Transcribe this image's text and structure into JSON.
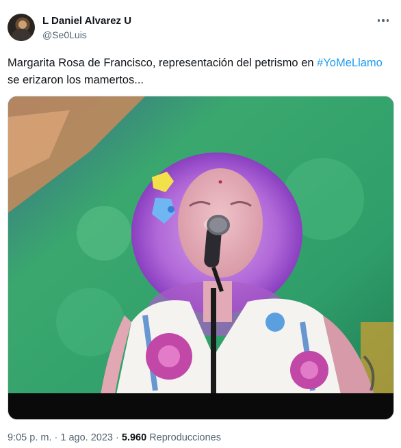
{
  "author": {
    "name": "L Daniel Alvarez U",
    "handle": "@Se0Luis"
  },
  "tweet": {
    "text_before": "Margarita Rosa de Francisco, representación del petrismo en ",
    "hashtag": "#YoMeLlamo",
    "text_after": " se erizaron los mamertos..."
  },
  "meta": {
    "time": "9:05 p. m.",
    "separator": " · ",
    "date": "1 ago. 2023",
    "separator2": " · ",
    "views": "5.960",
    "views_label": " Reproducciones"
  },
  "icons": {
    "more": "more-horizontal-icon"
  },
  "colors": {
    "link": "#1d9bf0",
    "secondary_text": "#536471"
  }
}
